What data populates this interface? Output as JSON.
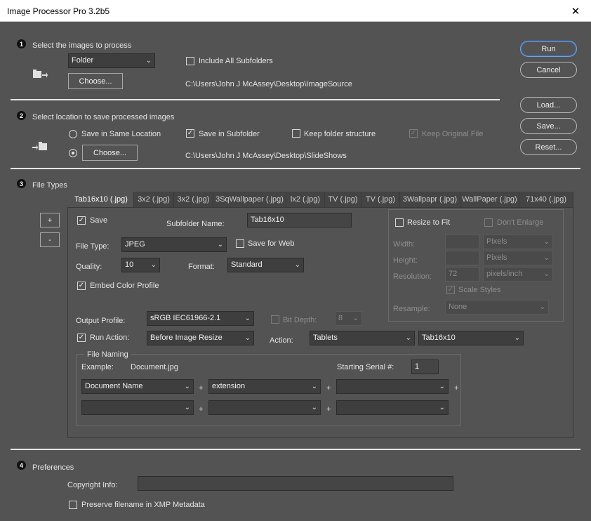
{
  "window": {
    "title": "Image Processor Pro 3.2b5",
    "close_glyph": "✕"
  },
  "section1": {
    "number": "1",
    "heading": "Select the images to process",
    "source_select": "Folder",
    "include_subfolders": {
      "label": "Include All Subfolders",
      "checked": false
    },
    "choose_label": "Choose...",
    "path": "C:\\Users\\John J McAssey\\Desktop\\ImageSource"
  },
  "actions": {
    "run": "Run",
    "cancel": "Cancel",
    "load": "Load...",
    "save": "Save...",
    "reset": "Reset..."
  },
  "section2": {
    "number": "2",
    "heading": "Select location to save processed images",
    "same_location": "Save in Same Location",
    "save_subfolder": {
      "label": "Save in Subfolder",
      "checked": true
    },
    "keep_structure": {
      "label": "Keep folder structure",
      "checked": false
    },
    "keep_original": {
      "label": "Keep Original File",
      "checked": true,
      "disabled": true
    },
    "choose_label": "Choose...",
    "path": "C:\\Users\\John J McAssey\\Desktop\\SlideShows"
  },
  "section3": {
    "number": "3",
    "heading": "File Types",
    "plus": "+",
    "minus": "-",
    "tabs": [
      "Tab16x10 (.jpg)",
      "3x2 (.jpg)",
      "3x2 (.jpg)",
      "3SqWallpaper (.jpg)",
      "lx2 (.jpg)",
      "TV (.jpg)",
      "TV (.jpg)",
      "3Wallpapr (.jpg)",
      "WallPaper (.jpg)",
      "71x40 (.jpg)"
    ],
    "save": {
      "label": "Save",
      "checked": true
    },
    "subfolder_label": "Subfolder Name:",
    "subfolder_value": "Tab16x10",
    "file_type_label": "File Type:",
    "file_type_value": "JPEG",
    "save_for_web": {
      "label": "Save for Web",
      "checked": false
    },
    "quality_label": "Quality:",
    "quality_value": "10",
    "format_label": "Format:",
    "format_value": "Standard",
    "embed_profile": {
      "label": "Embed Color Profile",
      "checked": true
    },
    "resize": {
      "resize_to_fit": "Resize to Fit",
      "dont_enlarge": "Don't Enlarge",
      "width_label": "Width:",
      "width_unit": "Pixels",
      "height_label": "Height:",
      "height_unit": "Pixels",
      "resolution_label": "Resolution:",
      "resolution_value": "72",
      "resolution_unit": "pixels/inch",
      "scale_styles": "Scale Styles",
      "resample_label": "Resample:",
      "resample_value": "None"
    },
    "output_profile_label": "Output Profile:",
    "output_profile_value": "sRGB IEC61966-2.1",
    "bit_depth_label": "Bit Depth:",
    "bit_depth_value": "8",
    "run_action": {
      "label": "Run Action:",
      "checked": true
    },
    "run_action_value": "Before Image Resize",
    "action_label": "Action:",
    "action_set": "Tablets",
    "action_name": "Tab16x10",
    "file_naming": {
      "legend": "File Naming",
      "example_label": "Example:",
      "example_value": "Document.jpg",
      "serial_label": "Starting Serial #:",
      "serial_value": "1",
      "row1": [
        "Document Name",
        "extension",
        ""
      ],
      "row2": [
        "",
        "",
        ""
      ],
      "plus": "+"
    }
  },
  "section4": {
    "number": "4",
    "heading": "Preferences",
    "copyright_label": "Copyright Info:",
    "copyright_value": "",
    "preserve_filename": {
      "label": "Preserve filename in XMP Metadata",
      "checked": false
    }
  },
  "glyphs": {
    "check": "✓",
    "chevron": "⌄"
  }
}
